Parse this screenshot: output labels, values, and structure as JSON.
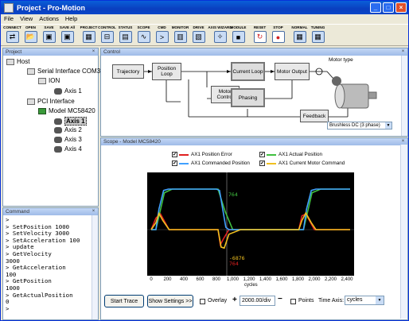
{
  "window": {
    "title": "Project - Pro-Motion"
  },
  "menu": [
    "File",
    "View",
    "Actions",
    "Help"
  ],
  "toolbar": [
    {
      "label": "CONNECT",
      "icon": "connect-icon",
      "glyph": "⇄"
    },
    {
      "label": "OPEN",
      "icon": "open-folder-icon",
      "glyph": "📂"
    },
    {
      "label": "SAVE",
      "icon": "save-icon",
      "glyph": "▣"
    },
    {
      "label": "SAVE All",
      "icon": "save-all-icon",
      "glyph": "▣"
    },
    {
      "label": "PROJECT",
      "icon": "project-icon",
      "glyph": "▦"
    },
    {
      "label": "CONTROL",
      "icon": "control-icon",
      "glyph": "⊟"
    },
    {
      "label": "STATUS",
      "icon": "status-icon",
      "glyph": "▤"
    },
    {
      "label": "SCOPE",
      "icon": "scope-icon",
      "glyph": "∿"
    },
    {
      "label": "CMD",
      "icon": "command-icon",
      "glyph": ">"
    },
    {
      "label": "MONITOR",
      "icon": "monitor-icon",
      "glyph": "▥"
    },
    {
      "label": "DRIVE",
      "icon": "drive-icon",
      "glyph": "▧"
    },
    {
      "label": "AXIS WIZARD",
      "icon": "wizard-icon",
      "glyph": "✧"
    },
    {
      "label": "MODULE",
      "icon": "module-icon",
      "glyph": "■"
    },
    {
      "label": "RESET",
      "icon": "reset-icon",
      "glyph": "↻"
    },
    {
      "label": "STOP",
      "icon": "stop-icon",
      "glyph": "●"
    },
    {
      "label": "NORMAL",
      "icon": "normal-icon",
      "glyph": "▦"
    },
    {
      "label": "TUNING",
      "icon": "tuning-icon",
      "glyph": "▦"
    }
  ],
  "project_panel": {
    "title": "Project",
    "nodes": [
      "Host",
      "Serial Interface COM3",
      "ION",
      "Axis 1",
      "PCI Interface",
      "Model MC58420",
      "Axis 1",
      "Axis 2",
      "Axis 3",
      "Axis 4"
    ]
  },
  "command_panel": {
    "title": "Command",
    "lines": [
      ">",
      "> SetPosition 1000",
      "> SetVelocity 3000",
      "> SetAcceleration 100",
      "> update",
      "> GetVelocity",
      "3000",
      "> GetAcceleration",
      "100",
      "> GetPosition",
      "1000",
      "> GetActualPosition",
      "0",
      ">"
    ]
  },
  "control_panel": {
    "title": "Control",
    "blocks": {
      "trajectory": "Trajectory",
      "position_loop": "Position Loop",
      "current_loop": "Current Loop",
      "motor_output": "Motor Output",
      "motor_control": "Motor Control",
      "phasing": "Phasing",
      "feedback": "Feedback"
    },
    "motor_type_label": "Motor type",
    "motor_type_value": "Brushless DC (3 phase)"
  },
  "scope_panel": {
    "title": "Scope - Model MC58420",
    "legend": [
      {
        "label": "AX1 Position Error",
        "color": "#e02020",
        "checked": "✔"
      },
      {
        "label": "AX1 Actual Position",
        "color": "#40c040",
        "checked": "✔"
      },
      {
        "label": "AX1 Commanded Position",
        "color": "#40a0ff",
        "checked": "✔"
      },
      {
        "label": "AX1 Current Motor Command",
        "color": "#f0c020",
        "checked": "✔"
      }
    ],
    "cursor_top_label": "764",
    "cursor_bottom_label": "-6876",
    "cursor_bottom_label2": "764",
    "x_axis_label": "cycles",
    "start_trace": "Start Trace",
    "show_settings": "Show Settings >>",
    "overlay_label": "Overlay",
    "zoom_value": "2000.00/div",
    "points_label": "Points",
    "time_axis_label": "Time Axis:",
    "time_axis_value": "cycles"
  },
  "chart_data": {
    "type": "line",
    "xlabel": "cycles",
    "xlim": [
      0,
      2560
    ],
    "x_ticks": [
      "0",
      "200",
      "400",
      "600",
      "800",
      "1,000",
      "1,200",
      "1,400",
      "1,600",
      "1,800",
      "2,000",
      "2,200",
      "2,400"
    ],
    "series": [
      {
        "name": "AX1 Position Error",
        "color": "#e02020",
        "x": [
          0,
          60,
          120,
          230,
          500,
          860,
          890,
          930,
          1000,
          1150,
          1900,
          1940,
          1990,
          2100,
          2560
        ],
        "y": [
          0,
          0.25,
          0.34,
          0,
          0,
          0,
          -0.33,
          -0.2,
          0,
          0,
          0,
          0.3,
          0.34,
          0,
          0
        ]
      },
      {
        "name": "AX1 Actual Position",
        "color": "#40c040",
        "x": [
          0,
          60,
          170,
          270,
          700,
          860,
          950,
          1050,
          1900,
          1960,
          2070,
          2180,
          2560
        ],
        "y": [
          0,
          0,
          0.8,
          0.88,
          0.88,
          0.88,
          0.4,
          0,
          0,
          0,
          0.8,
          0.88,
          0.88
        ]
      },
      {
        "name": "AX1 Commanded Position",
        "color": "#40a0ff",
        "x": [
          0,
          60,
          100,
          160,
          220,
          840,
          880,
          920,
          960,
          1000,
          1900,
          1960,
          2000,
          2060,
          2120,
          2560
        ],
        "y": [
          0,
          0,
          0.45,
          0.85,
          0.88,
          0.88,
          0.85,
          0.45,
          0.05,
          0,
          0,
          0,
          0.45,
          0.85,
          0.88,
          0.88
        ]
      },
      {
        "name": "AX1 Current Motor Command",
        "color": "#f0c020",
        "x": [
          0,
          60,
          100,
          150,
          230,
          860,
          900,
          940,
          1000,
          1150,
          1900,
          1940,
          1990,
          2060,
          2120,
          2560
        ],
        "y": [
          0,
          0.15,
          0.35,
          0.2,
          0,
          0,
          -0.38,
          -0.4,
          -0.1,
          0,
          0,
          0.2,
          0.36,
          0.15,
          0,
          0
        ]
      }
    ]
  }
}
